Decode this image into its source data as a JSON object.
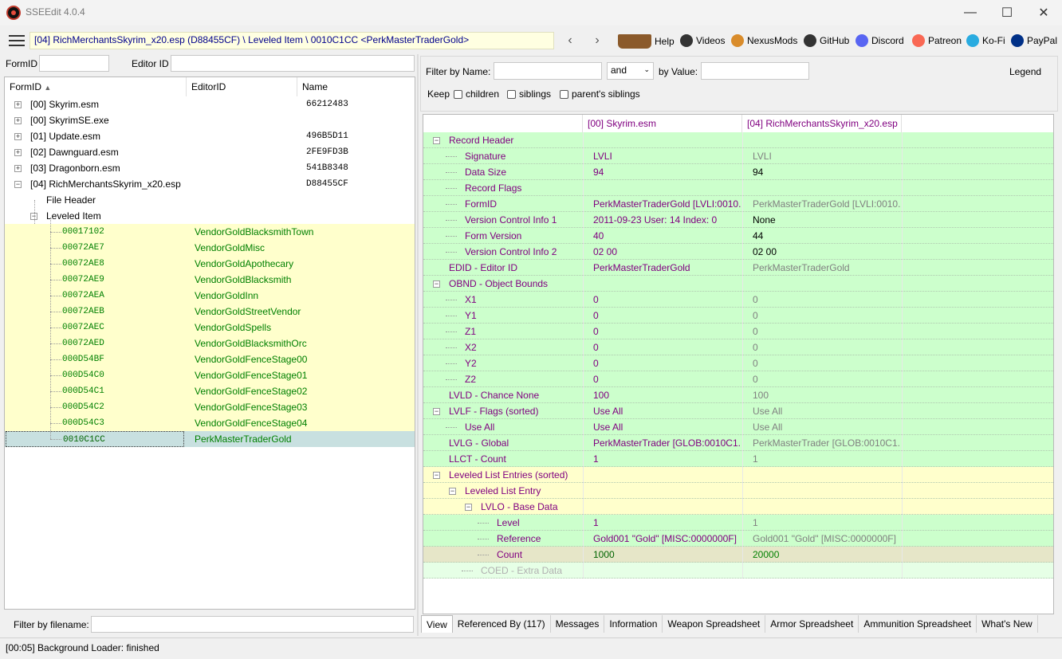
{
  "window": {
    "title": "SSEEdit 4.0.4"
  },
  "toolbar": {
    "path": "[04] RichMerchantsSkyrim_x20.esp (D88455CF) \\ Leveled Item \\ 0010C1CC <PerkMasterTraderGold>",
    "back": "‹",
    "forward": "›",
    "links": [
      {
        "label": "Help",
        "icon": "book-icon",
        "color": "#8b5a2b"
      },
      {
        "label": "Videos",
        "icon": "gp-icon",
        "color": "#333333"
      },
      {
        "label": "NexusMods",
        "icon": "nexus-icon",
        "color": "#d98c2b"
      },
      {
        "label": "GitHub",
        "icon": "github-icon",
        "color": "#333333"
      },
      {
        "label": "Discord",
        "icon": "discord-icon",
        "color": "#5865f2"
      },
      {
        "label": "Patreon",
        "icon": "patreon-icon",
        "color": "#f96854"
      },
      {
        "label": "Ko-Fi",
        "icon": "kofi-icon",
        "color": "#29abe0"
      },
      {
        "label": "PayPal",
        "icon": "paypal-icon",
        "color": "#003087"
      }
    ]
  },
  "left": {
    "formid_label": "FormID",
    "editorid_label": "Editor ID",
    "columns": [
      "FormID",
      "EditorID",
      "Name"
    ],
    "tree": [
      {
        "text": "[00] Skyrim.esm",
        "name": "66212483",
        "toggle": "+",
        "level": 0
      },
      {
        "text": "[00] SkyrimSE.exe",
        "name": "",
        "toggle": "+",
        "level": 0
      },
      {
        "text": "[01] Update.esm",
        "name": "496B5D11",
        "toggle": "+",
        "level": 0
      },
      {
        "text": "[02] Dawnguard.esm",
        "name": "2FE9FD3B",
        "toggle": "+",
        "level": 0
      },
      {
        "text": "[03] Dragonborn.esm",
        "name": "541B8348",
        "toggle": "+",
        "level": 0
      },
      {
        "text": "[04] RichMerchantsSkyrim_x20.esp",
        "name": "D88455CF",
        "toggle": "−",
        "level": 0
      },
      {
        "text": "File Header",
        "name": "",
        "toggle": "",
        "level": 1
      },
      {
        "text": "Leveled Item",
        "name": "",
        "toggle": "−",
        "level": 1
      }
    ],
    "records": [
      {
        "formid": "00017102",
        "editorid": "VendorGoldBlacksmithTown"
      },
      {
        "formid": "00072AE7",
        "editorid": "VendorGoldMisc"
      },
      {
        "formid": "00072AE8",
        "editorid": "VendorGoldApothecary"
      },
      {
        "formid": "00072AE9",
        "editorid": "VendorGoldBlacksmith"
      },
      {
        "formid": "00072AEA",
        "editorid": "VendorGoldInn"
      },
      {
        "formid": "00072AEB",
        "editorid": "VendorGoldStreetVendor"
      },
      {
        "formid": "00072AEC",
        "editorid": "VendorGoldSpells"
      },
      {
        "formid": "00072AED",
        "editorid": "VendorGoldBlacksmithOrc"
      },
      {
        "formid": "000D54BF",
        "editorid": "VendorGoldFenceStage00"
      },
      {
        "formid": "000D54C0",
        "editorid": "VendorGoldFenceStage01"
      },
      {
        "formid": "000D54C1",
        "editorid": "VendorGoldFenceStage02"
      },
      {
        "formid": "000D54C2",
        "editorid": "VendorGoldFenceStage03"
      },
      {
        "formid": "000D54C3",
        "editorid": "VendorGoldFenceStage04"
      },
      {
        "formid": "0010C1CC",
        "editorid": "PerkMasterTraderGold"
      }
    ],
    "filter_label": "Filter by filename:"
  },
  "right": {
    "filter_name_label": "Filter by Name:",
    "and_label": "and",
    "by_value_label": "by Value:",
    "legend": "Legend",
    "keep": "Keep",
    "children": "children",
    "siblings": "siblings",
    "parents_siblings": "parent's siblings",
    "col1": "[00] Skyrim.esm",
    "col2": "[04] RichMerchantsSkyrim_x20.esp",
    "rows": [
      {
        "label": "Record Header",
        "v1": "",
        "v2": "",
        "depth": 0,
        "toggle": "−",
        "bg": "#ccffcc"
      },
      {
        "label": "Signature",
        "v1": "LVLI",
        "v2": "LVLI",
        "depth": 1,
        "toggle": "",
        "bg": "#ccffcc"
      },
      {
        "label": "Data Size",
        "v1": "94",
        "v2": "94",
        "depth": 1,
        "toggle": "",
        "bg": "#ccffcc"
      },
      {
        "label": "Record Flags",
        "v1": "",
        "v2": "",
        "depth": 1,
        "toggle": "",
        "bg": "#ccffcc"
      },
      {
        "label": "FormID",
        "v1": "PerkMasterTraderGold [LVLI:0010...",
        "v2": "PerkMasterTraderGold [LVLI:0010...",
        "depth": 1,
        "toggle": "",
        "bg": "#ccffcc"
      },
      {
        "label": "Version Control Info 1",
        "v1": "2011-09-23 User: 14 Index: 0",
        "v2": "None",
        "depth": 1,
        "toggle": "",
        "bg": "#ccffcc"
      },
      {
        "label": "Form Version",
        "v1": "40",
        "v2": "44",
        "depth": 1,
        "toggle": "",
        "bg": "#ccffcc"
      },
      {
        "label": "Version Control Info 2",
        "v1": "02 00",
        "v2": "02 00",
        "depth": 1,
        "toggle": "",
        "bg": "#ccffcc"
      },
      {
        "label": "EDID - Editor ID",
        "v1": "PerkMasterTraderGold",
        "v2": "PerkMasterTraderGold",
        "depth": 0,
        "toggle": "",
        "bg": "#ccffcc"
      },
      {
        "label": "OBND - Object Bounds",
        "v1": "",
        "v2": "",
        "depth": 0,
        "toggle": "−",
        "bg": "#ccffcc"
      },
      {
        "label": "X1",
        "v1": "0",
        "v2": "0",
        "depth": 1,
        "toggle": "",
        "bg": "#ccffcc"
      },
      {
        "label": "Y1",
        "v1": "0",
        "v2": "0",
        "depth": 1,
        "toggle": "",
        "bg": "#ccffcc"
      },
      {
        "label": "Z1",
        "v1": "0",
        "v2": "0",
        "depth": 1,
        "toggle": "",
        "bg": "#ccffcc"
      },
      {
        "label": "X2",
        "v1": "0",
        "v2": "0",
        "depth": 1,
        "toggle": "",
        "bg": "#ccffcc"
      },
      {
        "label": "Y2",
        "v1": "0",
        "v2": "0",
        "depth": 1,
        "toggle": "",
        "bg": "#ccffcc"
      },
      {
        "label": "Z2",
        "v1": "0",
        "v2": "0",
        "depth": 1,
        "toggle": "",
        "bg": "#ccffcc"
      },
      {
        "label": "LVLD - Chance None",
        "v1": "100",
        "v2": "100",
        "depth": 0,
        "toggle": "",
        "bg": "#ccffcc"
      },
      {
        "label": "LVLF - Flags (sorted)",
        "v1": "Use All",
        "v2": "Use All",
        "depth": 0,
        "toggle": "−",
        "bg": "#ccffcc"
      },
      {
        "label": "Use All",
        "v1": "Use All",
        "v2": "Use All",
        "depth": 1,
        "toggle": "",
        "bg": "#ccffcc"
      },
      {
        "label": "LVLG - Global",
        "v1": "PerkMasterTrader [GLOB:0010C1...",
        "v2": "PerkMasterTrader [GLOB:0010C1...",
        "depth": 0,
        "toggle": "",
        "bg": "#ccffcc"
      },
      {
        "label": "LLCT - Count",
        "v1": "1",
        "v2": "1",
        "depth": 0,
        "toggle": "",
        "bg": "#ccffcc"
      },
      {
        "label": "Leveled List Entries (sorted)",
        "v1": "",
        "v2": "",
        "depth": 0,
        "toggle": "−",
        "bg": "#ffffcc"
      },
      {
        "label": "Leveled List Entry",
        "v1": "",
        "v2": "",
        "depth": 1,
        "toggle": "−",
        "bg": "#ffffcc"
      },
      {
        "label": "LVLO - Base Data",
        "v1": "",
        "v2": "",
        "depth": 2,
        "toggle": "−",
        "bg": "#ffffcc"
      },
      {
        "label": "Level",
        "v1": "1",
        "v2": "1",
        "depth": 3,
        "toggle": "",
        "bg": "#ccffcc"
      },
      {
        "label": "Reference",
        "v1": "Gold001 \"Gold\" [MISC:0000000F]",
        "v2": "Gold001 \"Gold\" [MISC:0000000F]",
        "depth": 3,
        "toggle": "",
        "bg": "#ccffcc"
      },
      {
        "label": "Count",
        "v1": "1000",
        "v2": "20000",
        "depth": 3,
        "toggle": "",
        "bg": "#e6e6c8"
      },
      {
        "label": "COED - Extra Data",
        "v1": "",
        "v2": "",
        "depth": 2,
        "toggle": "",
        "bg": "#e6ffe6"
      }
    ],
    "tabs": [
      "View",
      "Referenced By (117)",
      "Messages",
      "Information",
      "Weapon Spreadsheet",
      "Armor Spreadsheet",
      "Ammunition Spreadsheet",
      "What's New"
    ]
  },
  "status": "[00:05] Background Loader: finished"
}
